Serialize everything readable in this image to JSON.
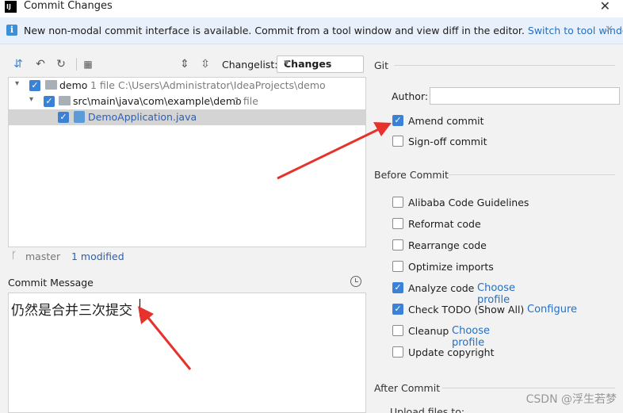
{
  "window": {
    "title": "Commit Changes",
    "close": "✕"
  },
  "banner": {
    "text": "New non-modal commit interface is available. Commit from a tool window and view diff in the editor.",
    "link": "Switch to tool window",
    "close": "✕"
  },
  "toolbar": {
    "changelist_label": "Changelist:",
    "changelist_value": "Changes",
    "icons": [
      "move-to-changelist-icon",
      "undo-icon",
      "refresh-icon",
      "group-by-icon",
      "expand-all-icon",
      "collapse-all-icon"
    ]
  },
  "tree": {
    "rows": [
      {
        "name": "demo",
        "count": "1 file",
        "path": "C:\\Users\\Administrator\\IdeaProjects\\demo"
      },
      {
        "name": "src\\main\\java\\com\\example\\demo",
        "count": "1 file"
      },
      {
        "name": "DemoApplication.java"
      }
    ]
  },
  "status": {
    "branch": "master",
    "modified": "1 modified"
  },
  "commit_message": {
    "label": "Commit Message",
    "text": "仍然是合并三次提交"
  },
  "git": {
    "title": "Git",
    "author_label": "Author:",
    "author_value": "",
    "amend": "Amend commit",
    "signoff": "Sign-off commit"
  },
  "before_commit": {
    "title": "Before Commit",
    "options": [
      {
        "label": "Alibaba Code Guidelines",
        "checked": false,
        "link": ""
      },
      {
        "label": "Reformat code",
        "checked": false,
        "link": ""
      },
      {
        "label": "Rearrange code",
        "checked": false,
        "link": ""
      },
      {
        "label": "Optimize imports",
        "checked": false,
        "link": ""
      },
      {
        "label": "Analyze code",
        "checked": true,
        "link": "Choose profile"
      },
      {
        "label": "Check TODO (Show All)",
        "checked": true,
        "link": "Configure"
      },
      {
        "label": "Cleanup",
        "checked": false,
        "link": "Choose profile"
      },
      {
        "label": "Update copyright",
        "checked": false,
        "link": ""
      }
    ]
  },
  "after_commit": {
    "title": "After Commit",
    "partial": "Upload files to:"
  },
  "watermark": "CSDN @浮生若梦",
  "colors": {
    "accent": "#3b82d6",
    "link": "#2470c5",
    "arrow": "#e5322d"
  }
}
